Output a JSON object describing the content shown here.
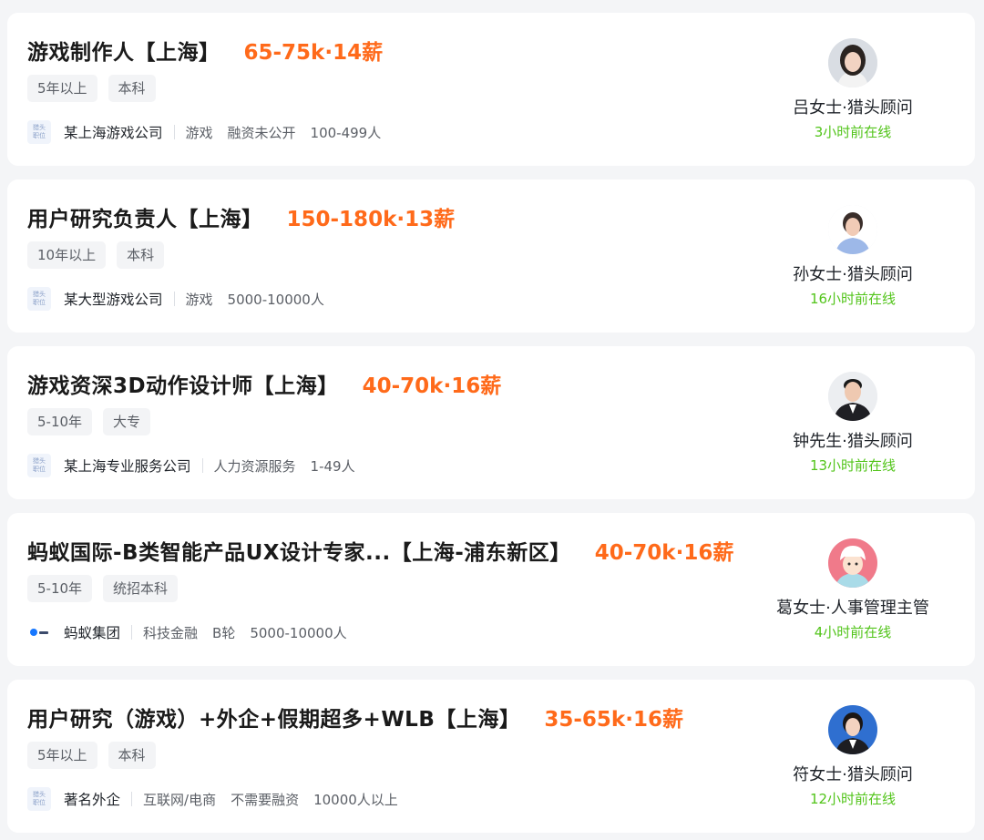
{
  "jobs": [
    {
      "title": "游戏制作人【上海】",
      "salary": "65-75k·14薪",
      "tags": [
        "5年以上",
        "本科"
      ],
      "logo_text": [
        "猎头",
        "职位"
      ],
      "company": "某上海游戏公司",
      "meta": [
        "游戏",
        "融资未公开",
        "100-499人"
      ],
      "recruiter": "吕女士·猎头顾问",
      "online": "3小时前在线",
      "avatar_icon": "female-avatar-icon"
    },
    {
      "title": "用户研究负责人【上海】",
      "salary": "150-180k·13薪",
      "tags": [
        "10年以上",
        "本科"
      ],
      "logo_text": [
        "猎头",
        "职位"
      ],
      "company": "某大型游戏公司",
      "meta": [
        "游戏",
        "5000-10000人"
      ],
      "recruiter": "孙女士·猎头顾问",
      "online": "16小时前在线",
      "avatar_icon": "female-avatar-icon"
    },
    {
      "title": "游戏资深3D动作设计师【上海】",
      "salary": "40-70k·16薪",
      "tags": [
        "5-10年",
        "大专"
      ],
      "logo_text": [
        "猎头",
        "职位"
      ],
      "company": "某上海专业服务公司",
      "meta": [
        "人力资源服务",
        "1-49人"
      ],
      "recruiter": "钟先生·猎头顾问",
      "online": "13小时前在线",
      "avatar_icon": "male-avatar-icon"
    },
    {
      "title": "蚂蚁国际-B类智能产品UX设计专家...【上海-浦东新区】",
      "salary": "40-70k·16薪",
      "tags": [
        "5-10年",
        "统招本科"
      ],
      "logo_text": [],
      "company": "蚂蚁集团",
      "meta": [
        "科技金融",
        "B轮",
        "5000-10000人"
      ],
      "recruiter": "葛女士·人事管理主管",
      "online": "4小时前在线",
      "avatar_icon": "cartoon-avatar-icon"
    },
    {
      "title": "用户研究（游戏）+外企+假期超多+WLB【上海】",
      "salary": "35-65k·16薪",
      "tags": [
        "5年以上",
        "本科"
      ],
      "logo_text": [
        "猎头",
        "职位"
      ],
      "company": "著名外企",
      "meta": [
        "互联网/电商",
        "不需要融资",
        "10000人以上"
      ],
      "recruiter": "符女士·猎头顾问",
      "online": "12小时前在线",
      "avatar_icon": "female-avatar-icon"
    }
  ],
  "colors": {
    "salary": "#ff6a1a",
    "online": "#52c41a",
    "background": "#f4f5f7"
  }
}
